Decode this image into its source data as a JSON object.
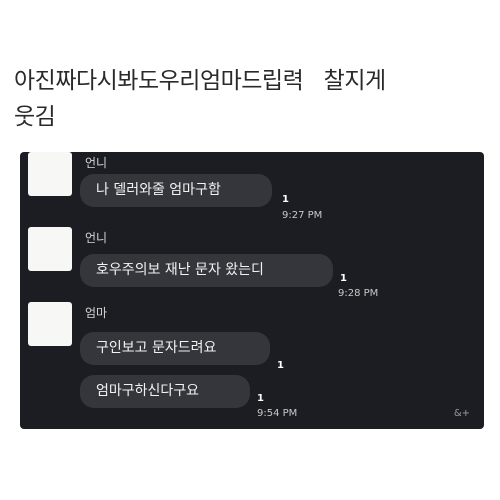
{
  "caption": {
    "line1": "아진짜다시봐도우리엄마드립력   찰지게",
    "line2": "웃김"
  },
  "chat": {
    "messages": [
      {
        "sender": "언니",
        "text": "나 델러와줄 엄마구함",
        "unread": "1",
        "time": "9:27 PM"
      },
      {
        "sender": "언니",
        "text": "호우주의보 재난 문자 왔는디",
        "unread": "1",
        "time": "9:28 PM"
      },
      {
        "sender": "엄마",
        "text": "구인보고 문자드려요",
        "unread": "1",
        "time": ""
      },
      {
        "sender": "",
        "text": "엄마구하신다구요",
        "unread": "1",
        "time": "9:54 PM"
      }
    ],
    "corner_mark": "&+"
  }
}
